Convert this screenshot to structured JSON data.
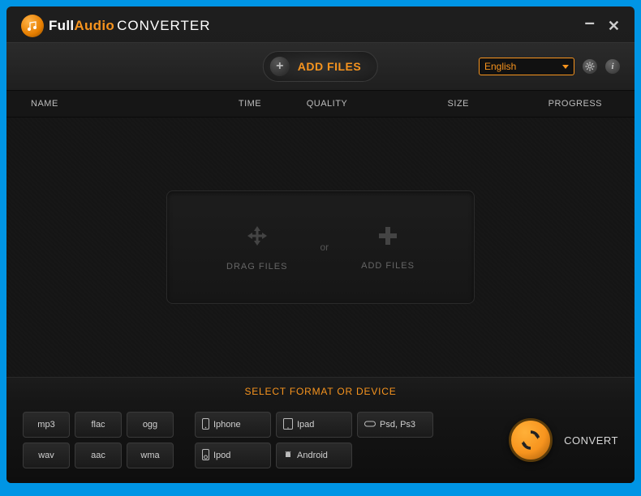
{
  "app": {
    "brand_full": "Full",
    "brand_audio": "Audio",
    "brand_converter": "CONVERTER"
  },
  "toolbar": {
    "add_files_label": "ADD FILES",
    "language_selected": "English"
  },
  "columns": {
    "name": "NAME",
    "time": "TIME",
    "quality": "QUALITY",
    "size": "SIZE",
    "progress": "PROGRESS"
  },
  "dropzone": {
    "drag_label": "DRAG FILES",
    "or_label": "or",
    "add_label": "ADD FILES"
  },
  "format_section_label": "SELECT FORMAT OR DEVICE",
  "formats": {
    "f0": "mp3",
    "f1": "flac",
    "f2": "ogg",
    "f3": "wav",
    "f4": "aac",
    "f5": "wma"
  },
  "devices": {
    "d0": "Iphone",
    "d1": "Ipad",
    "d2": "Psd, Ps3",
    "d3": "Ipod",
    "d4": "Android"
  },
  "convert": {
    "label": "CONVERT"
  }
}
